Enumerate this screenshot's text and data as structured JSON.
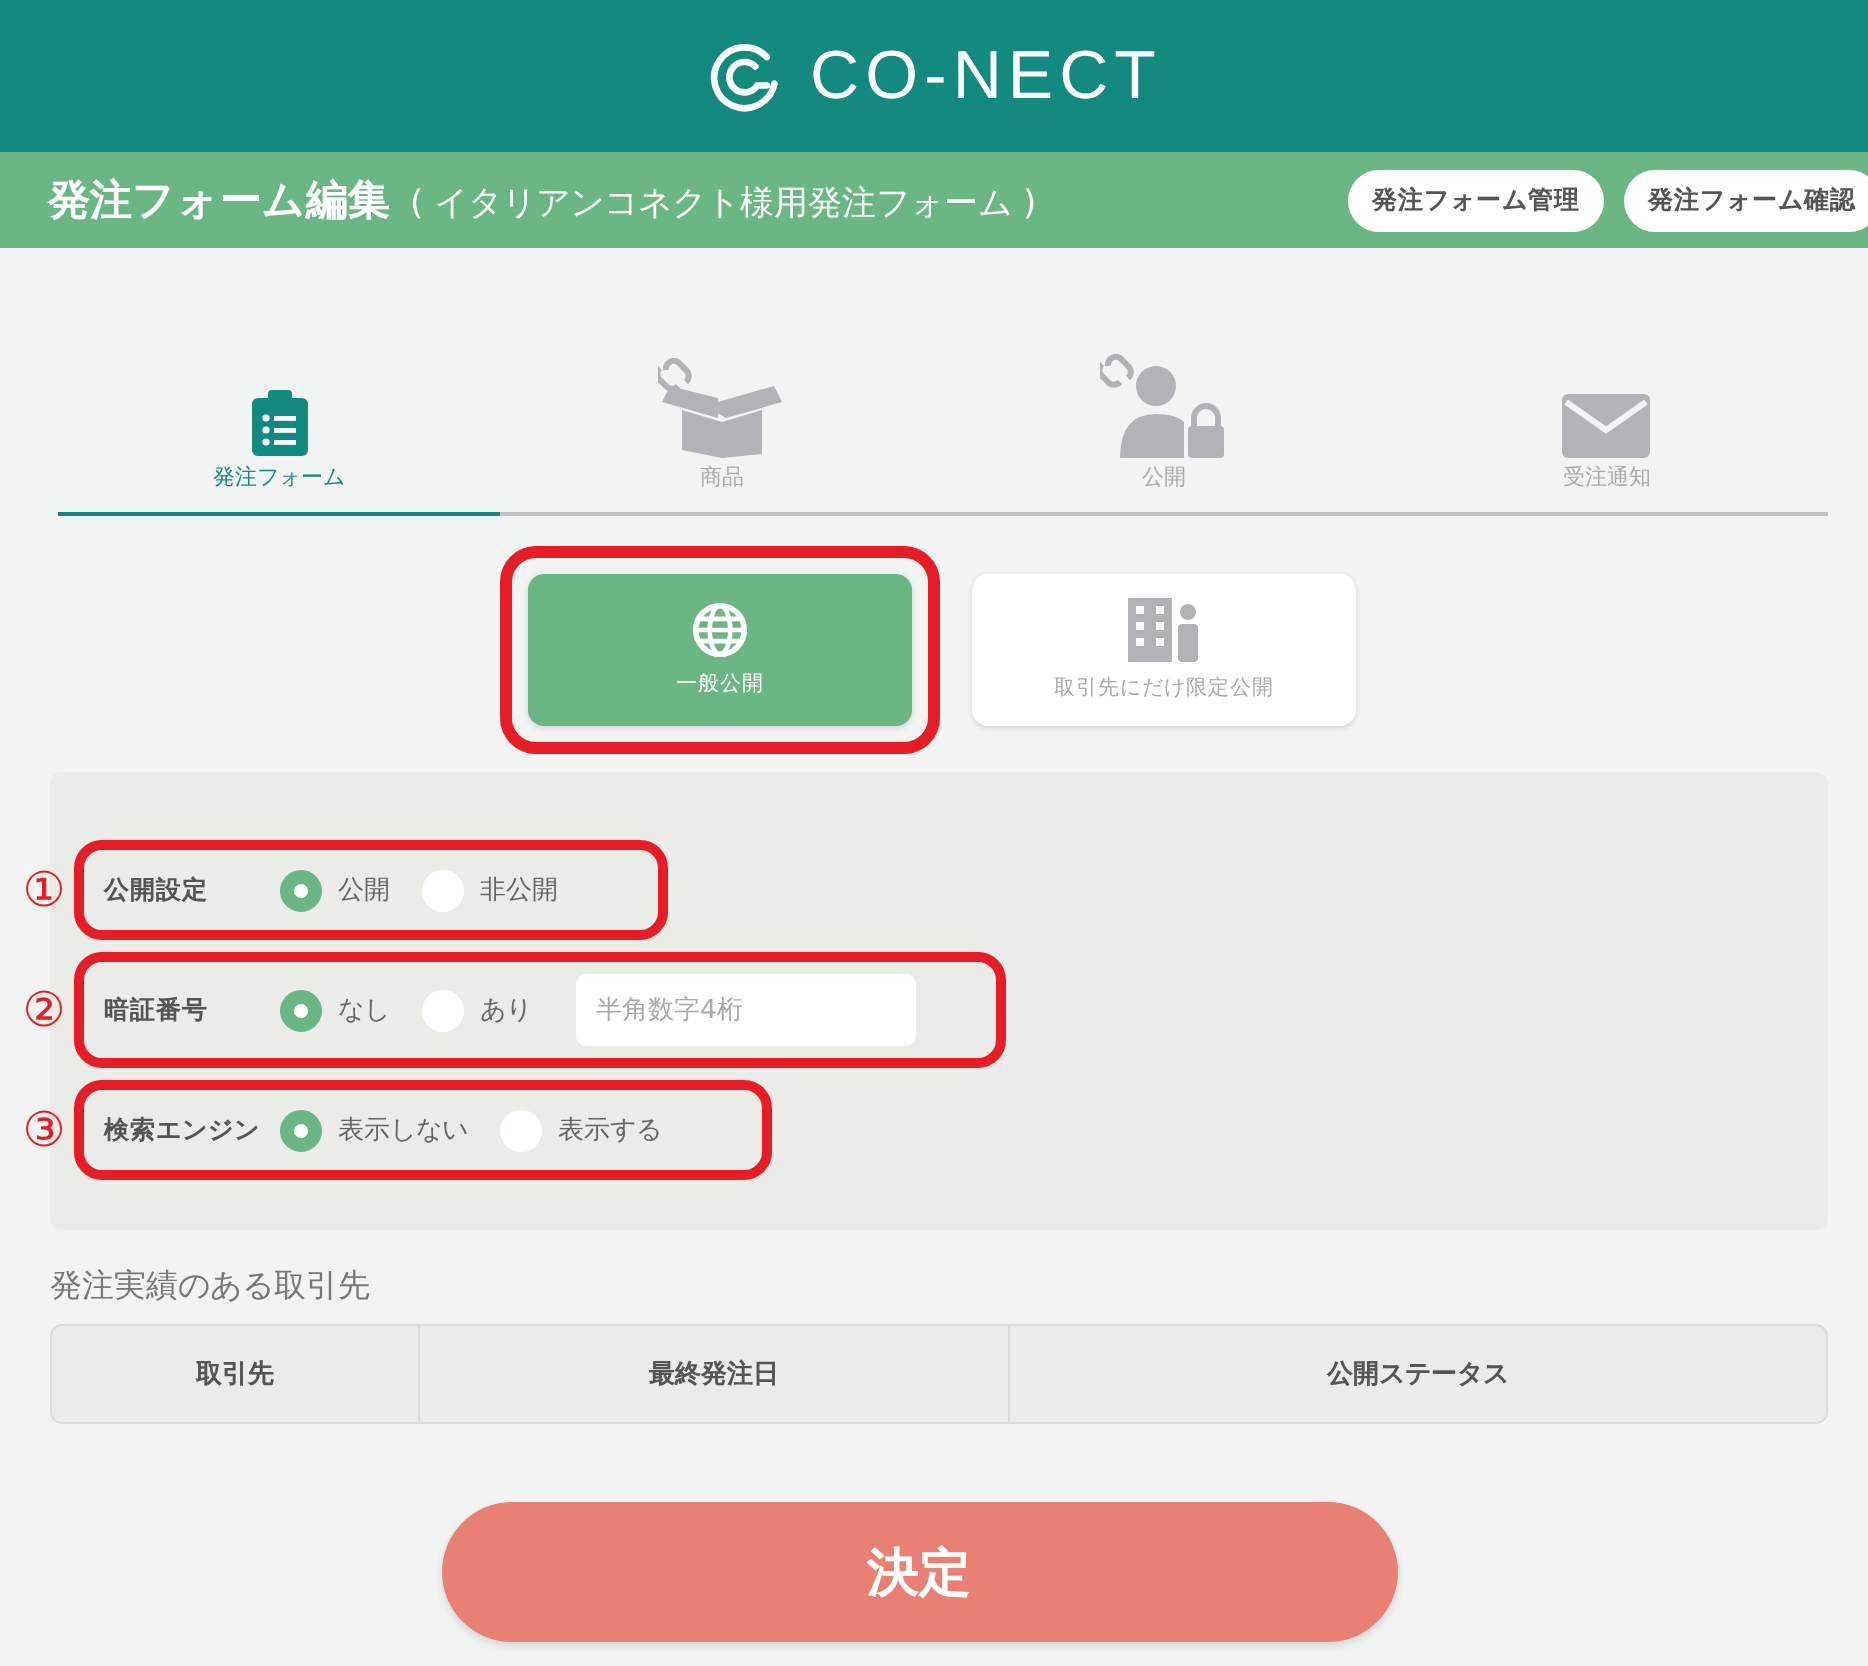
{
  "header": {
    "logo": "CO-NECT"
  },
  "title_bar": {
    "title": "発注フォーム編集",
    "subtitle": "( イタリアンコネクト様用発注フォーム )",
    "buttons": [
      "発注フォーム管理",
      "発注フォーム確認"
    ]
  },
  "tabs": [
    {
      "label": "発注フォーム",
      "kind": "form",
      "selected": true
    },
    {
      "label": "商品",
      "kind": "box",
      "selected": false
    },
    {
      "label": "公開",
      "kind": "person",
      "selected": false
    },
    {
      "label": "受注通知",
      "kind": "mail",
      "selected": false
    }
  ],
  "publish_options": [
    {
      "label": "一般公開",
      "kind": "globe",
      "selected": true,
      "highlighted": true
    },
    {
      "label": "取引先にだけ限定公開",
      "kind": "building",
      "selected": false,
      "highlighted": false
    }
  ],
  "settings": [
    {
      "marker": "①",
      "label": "公開設定",
      "highlighted": true,
      "options": [
        {
          "label": "公開",
          "selected": true
        },
        {
          "label": "非公開",
          "selected": false
        }
      ]
    },
    {
      "marker": "②",
      "label": "暗証番号",
      "highlighted": true,
      "options": [
        {
          "label": "なし",
          "selected": true
        },
        {
          "label": "あり",
          "selected": false
        }
      ],
      "field": {
        "placeholder": "半角数字4桁"
      }
    },
    {
      "marker": "③",
      "label": "検索エンジン",
      "highlighted": true,
      "options": [
        {
          "label": "表示しない",
          "selected": true
        },
        {
          "label": "表示する",
          "selected": false
        }
      ]
    }
  ],
  "partners": {
    "title": "発注実績のある取引先",
    "columns": [
      "取引先",
      "最終発注日",
      "公開ステータス"
    ]
  },
  "submit": "決定"
}
